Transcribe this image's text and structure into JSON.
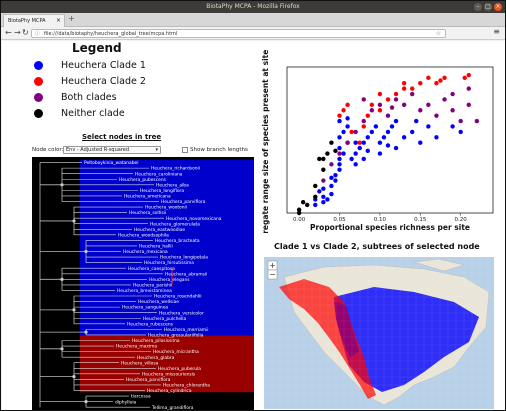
{
  "browser": {
    "window_title": "BiotaPhy MCPA - Mozilla Firefox",
    "tab_title": "BiotaPhy MCPA",
    "url": "file:///data/biotaphy/heuchera_global_tree/mcpa.html"
  },
  "legend": {
    "title": "Legend",
    "items": [
      {
        "label": "Heuchera Clade 1",
        "color": "#0000ff"
      },
      {
        "label": "Heuchera Clade 2",
        "color": "#ff0000"
      },
      {
        "label": "Both clades",
        "color": "#800080"
      },
      {
        "label": "Neither clade",
        "color": "#000000"
      }
    ]
  },
  "tree": {
    "heading": "Select nodes in tree",
    "node_color_label": "Node color:",
    "node_color_value": "Env - Adjusted R-squared",
    "branch_lengths_label": "Show branch lengths",
    "clade1_color": "#0000cc",
    "clade2_color": "#990000",
    "tips": [
      "Peltoboykinia_watanabei",
      "Heuchera_richardsonii",
      "Heuchera_caroliniana",
      "Heuchera_pubescens",
      "Heuchera_alba",
      "Heuchera_longiflora",
      "Heuchera_americana",
      "Heuchera_parviflora",
      "Heuchera_wootonii",
      "Heuchera_soltisii",
      "Heuchera_novomexicana",
      "Heuchera_glomerulata",
      "Heuchera_eastwoodiae",
      "Heuchera_woodsaphila",
      "Heuchera_bracteata",
      "Heuchera_hallii",
      "Heuchera_mexicana",
      "Heuchera_longipetala",
      "Heuchera_hirsutissima",
      "Heuchera_caespitosa",
      "Heuchera_abramsii",
      "Heuchera_elegans",
      "Heuchera_parishii",
      "Heuchera_brevistaminea",
      "Heuchera_rosendahlii",
      "Heuchera_wellsiae",
      "Heuchera_sanguinea",
      "Heuchera_versicolor",
      "Heuchera_pulchella",
      "Heuchera_rubescens",
      "Heuchera_merriamii",
      "Heuchera_grossulariifolia",
      "Heuchera_pilosissima",
      "Heuchera_maxima",
      "Heuchera_micrantha",
      "Heuchera_glabra",
      "Heuchera_villosa",
      "Heuchera_puberula",
      "Heuchera_missouriensis",
      "Heuchera_parviflora",
      "Heuchera_chlorantha",
      "Heuchera_cylindrica",
      "tiarcossa",
      "diphylleia",
      "Tellima_grandiflora"
    ]
  },
  "scatter": {
    "chart_data": {
      "type": "scatter",
      "xlabel": "Proportional species richness per site",
      "ylabel": "Aggregate range size of species present at site",
      "xlim": [
        -0.015,
        0.24
      ],
      "ylim": [
        0,
        2700
      ],
      "xticks": [
        "0.00",
        "0.05",
        "0.10",
        "0.15",
        "0.20"
      ],
      "xtick_values": [
        0.0,
        0.05,
        0.1,
        0.15,
        0.2
      ],
      "series": [
        {
          "color": "#0000ff",
          "points": [
            [
              0.02,
              150
            ],
            [
              0.02,
              250
            ],
            [
              0.025,
              400
            ],
            [
              0.03,
              200
            ],
            [
              0.03,
              300
            ],
            [
              0.035,
              250
            ],
            [
              0.04,
              500
            ],
            [
              0.04,
              350
            ],
            [
              0.045,
              600
            ],
            [
              0.045,
              700
            ],
            [
              0.05,
              800
            ],
            [
              0.05,
              900
            ],
            [
              0.05,
              1000
            ],
            [
              0.05,
              1200
            ],
            [
              0.05,
              1400
            ],
            [
              0.055,
              1100
            ],
            [
              0.055,
              1500
            ],
            [
              0.06,
              1300
            ],
            [
              0.06,
              1600
            ],
            [
              0.07,
              900
            ],
            [
              0.07,
              1100
            ],
            [
              0.075,
              1200
            ],
            [
              0.08,
              1000
            ],
            [
              0.08,
              1300
            ],
            [
              0.085,
              1400
            ],
            [
              0.09,
              1500
            ],
            [
              0.095,
              1600
            ],
            [
              0.1,
              1100
            ],
            [
              0.1,
              1300
            ],
            [
              0.105,
              1400
            ],
            [
              0.11,
              1500
            ],
            [
              0.115,
              1600
            ],
            [
              0.12,
              1200
            ],
            [
              0.13,
              1400
            ],
            [
              0.14,
              1500
            ],
            [
              0.15,
              1300
            ],
            [
              0.16,
              1600
            ],
            [
              0.17,
              1400
            ],
            [
              0.19,
              1600
            ],
            [
              0.2,
              1500
            ],
            [
              0.03,
              450
            ],
            [
              0.04,
              650
            ],
            [
              0.05,
              1700
            ],
            [
              0.06,
              1750
            ],
            [
              0.065,
              1000
            ],
            [
              0.07,
              1300
            ],
            [
              0.085,
              1150
            ],
            [
              0.11,
              1250
            ],
            [
              0.12,
              1700
            ],
            [
              0.145,
              1700
            ]
          ]
        },
        {
          "color": "#ff0000",
          "points": [
            [
              0.05,
              1800
            ],
            [
              0.055,
              1900
            ],
            [
              0.06,
              2000
            ],
            [
              0.075,
              1300
            ],
            [
              0.08,
              1600
            ],
            [
              0.085,
              1800
            ],
            [
              0.09,
              2000
            ],
            [
              0.1,
              1900
            ],
            [
              0.11,
              2100
            ],
            [
              0.12,
              2200
            ],
            [
              0.13,
              2300
            ],
            [
              0.14,
              2300
            ],
            [
              0.15,
              2400
            ],
            [
              0.16,
              2500
            ],
            [
              0.175,
              2450
            ],
            [
              0.18,
              2500
            ],
            [
              0.205,
              2500
            ],
            [
              0.21,
              2550
            ],
            [
              0.1,
              2200
            ],
            [
              0.13,
              2400
            ],
            [
              0.065,
              1500
            ],
            [
              0.17,
              2400
            ]
          ]
        },
        {
          "color": "#800080",
          "points": [
            [
              0.03,
              600
            ],
            [
              0.04,
              900
            ],
            [
              0.05,
              1100
            ],
            [
              0.06,
              1300
            ],
            [
              0.07,
              1500
            ],
            [
              0.08,
              1700
            ],
            [
              0.09,
              1900
            ],
            [
              0.1,
              2000
            ],
            [
              0.11,
              1800
            ],
            [
              0.12,
              2100
            ],
            [
              0.13,
              2000
            ],
            [
              0.14,
              2200
            ],
            [
              0.15,
              1900
            ],
            [
              0.16,
              2000
            ],
            [
              0.17,
              1800
            ],
            [
              0.18,
              2100
            ],
            [
              0.19,
              2200
            ],
            [
              0.2,
              1700
            ],
            [
              0.21,
              2000
            ],
            [
              0.22,
              1700
            ],
            [
              0.21,
              2300
            ],
            [
              0.19,
              1900
            ],
            [
              0.08,
              2100
            ],
            [
              0.115,
              1950
            ]
          ]
        },
        {
          "color": "#000000",
          "points": [
            [
              0.0,
              0
            ],
            [
              0.0,
              60
            ],
            [
              0.005,
              200
            ],
            [
              0.01,
              150
            ],
            [
              0.02,
              300
            ],
            [
              0.02,
              500
            ],
            [
              0.025,
              1000
            ],
            [
              0.03,
              1000
            ],
            [
              0.03,
              800
            ],
            [
              0.035,
              1100
            ],
            [
              0.04,
              1300
            ],
            [
              0.045,
              1150
            ]
          ]
        }
      ]
    }
  },
  "map": {
    "heading": "Clade 1 vs Clade 2, subtrees of selected node",
    "clade1_color": "#0000ff",
    "clade2_color": "#ff0000"
  }
}
